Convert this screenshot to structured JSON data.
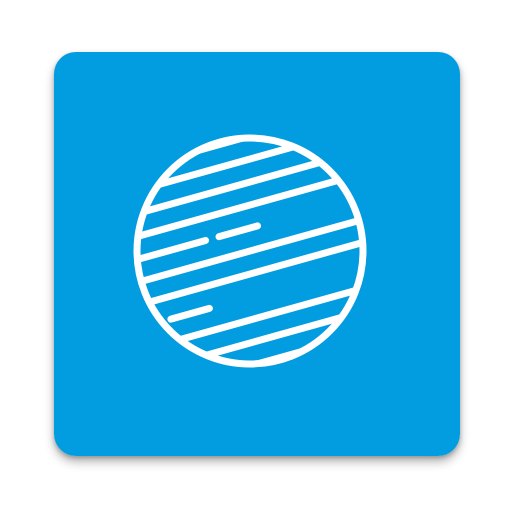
{
  "icon": {
    "name": "striped-globe-icon",
    "background_color": "#029DE0",
    "stroke_color": "#FFFFFF"
  }
}
